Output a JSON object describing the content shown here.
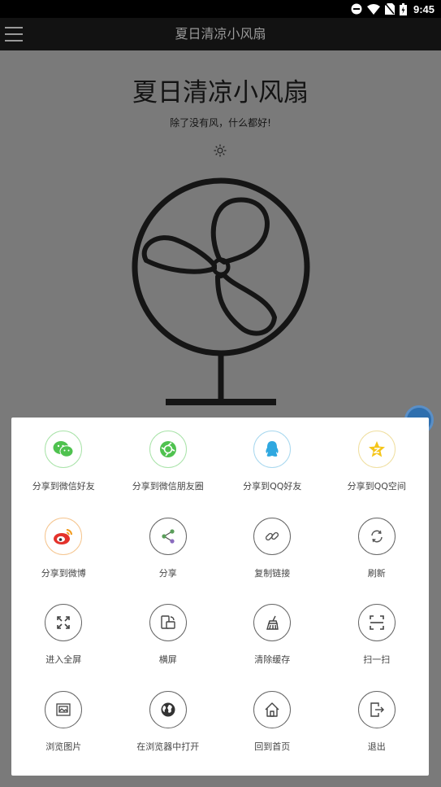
{
  "status_bar": {
    "time": "9:45",
    "icons": [
      "do-not-disturb-icon",
      "wifi-icon",
      "no-sim-icon",
      "battery-icon"
    ]
  },
  "app_bar": {
    "title": "夏日清凉小风扇",
    "menu_icon": "hamburger-menu-icon"
  },
  "page": {
    "heading": "夏日清凉小风扇",
    "subtitle": "除了没有风，什么都好!",
    "icons": [
      "sun-icon",
      "fan-illustration"
    ]
  },
  "share_sheet": {
    "items": [
      {
        "label": "分享到微信好友",
        "icon": "wechat-icon"
      },
      {
        "label": "分享到微信朋友圈",
        "icon": "wechat-moments-icon"
      },
      {
        "label": "分享到QQ好友",
        "icon": "qq-icon"
      },
      {
        "label": "分享到QQ空间",
        "icon": "qzone-icon"
      },
      {
        "label": "分享到微博",
        "icon": "weibo-icon"
      },
      {
        "label": "分享",
        "icon": "share-icon"
      },
      {
        "label": "复制链接",
        "icon": "link-icon"
      },
      {
        "label": "刷新",
        "icon": "refresh-icon"
      },
      {
        "label": "进入全屏",
        "icon": "fullscreen-icon"
      },
      {
        "label": "横屏",
        "icon": "rotate-screen-icon"
      },
      {
        "label": "清除缓存",
        "icon": "broom-icon"
      },
      {
        "label": "扫一扫",
        "icon": "scan-icon"
      },
      {
        "label": "浏览图片",
        "icon": "image-icon"
      },
      {
        "label": "在浏览器中打开",
        "icon": "globe-icon"
      },
      {
        "label": "回到首页",
        "icon": "home-icon"
      },
      {
        "label": "退出",
        "icon": "exit-icon"
      }
    ]
  },
  "colors": {
    "wechat_green": "#4fc24f",
    "qq_blue": "#2fa8e0",
    "qzone_yellow": "#f5c518",
    "weibo_orange": "#f29b1d",
    "overlay_gray": "#7a7a7a"
  }
}
